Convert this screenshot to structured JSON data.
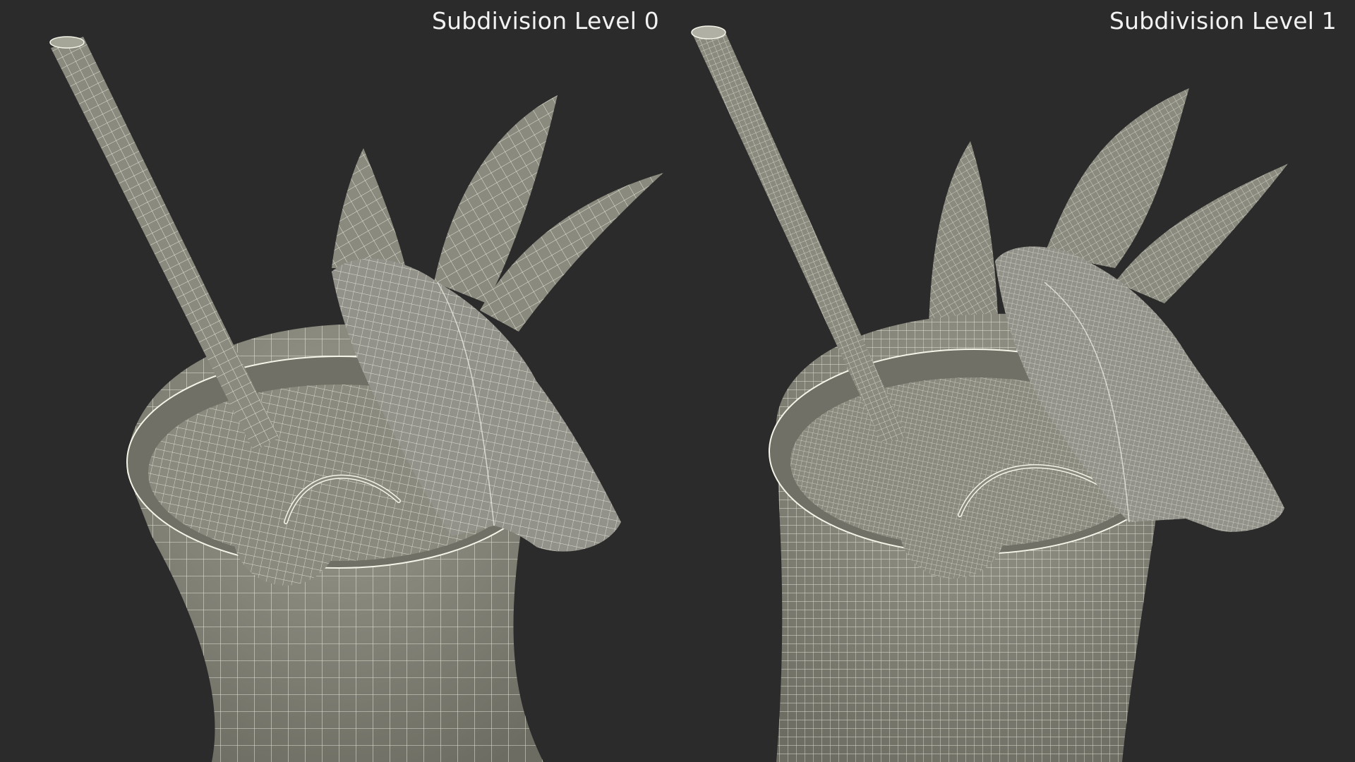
{
  "panels": [
    {
      "title": "Subdivision Level 0",
      "subdivision_level": 0
    },
    {
      "title": "Subdivision Level 1",
      "subdivision_level": 1
    }
  ],
  "colors": {
    "background": "#2b2b2b",
    "mesh_fill": "#8a8a7e",
    "mesh_shade": "#5e5e55",
    "wire": "#f4f4e8",
    "title_text": "#f2f2f2"
  }
}
